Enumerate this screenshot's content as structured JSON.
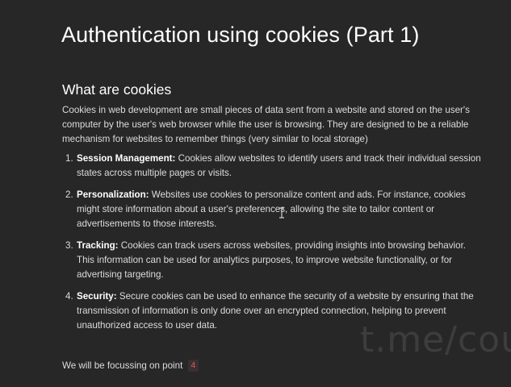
{
  "title": "Authentication using cookies (Part 1)",
  "section_heading": "What are cookies",
  "intro": "Cookies in web development are small pieces of data sent from a website and stored on the user's computer by the user's web browser while the user is browsing. They are designed to be a reliable mechanism for websites to remember things (very similar to local storage)",
  "items": [
    {
      "number": "1.",
      "term": "Session Management:",
      "text": " Cookies allow websites to identify users and track their individual session states across multiple pages or visits."
    },
    {
      "number": "2.",
      "term": "Personalization:",
      "text": " Websites use cookies to personalize content and ads. For instance, cookies might store information about a user's preferences, allowing the site to tailor content or advertisements to those interests."
    },
    {
      "number": "3.",
      "term": "Tracking:",
      "text": " Cookies can track users across websites, providing insights into browsing behavior. This information can be used for analytics purposes, to improve website functionality, or for advertising targeting."
    },
    {
      "number": "4.",
      "term": "Security:",
      "text": " Secure cookies can be used to enhance the security of a website by ensuring that the transmission of information is only done over an encrypted connection, helping to prevent unauthorized access to user data."
    }
  ],
  "footer": {
    "text": "We will be focussing on point",
    "point": "4"
  },
  "watermark": "t.me/cou",
  "colors": {
    "background": "#272727",
    "badge_text": "#e0605a",
    "badge_background": "#3b2f2f"
  }
}
